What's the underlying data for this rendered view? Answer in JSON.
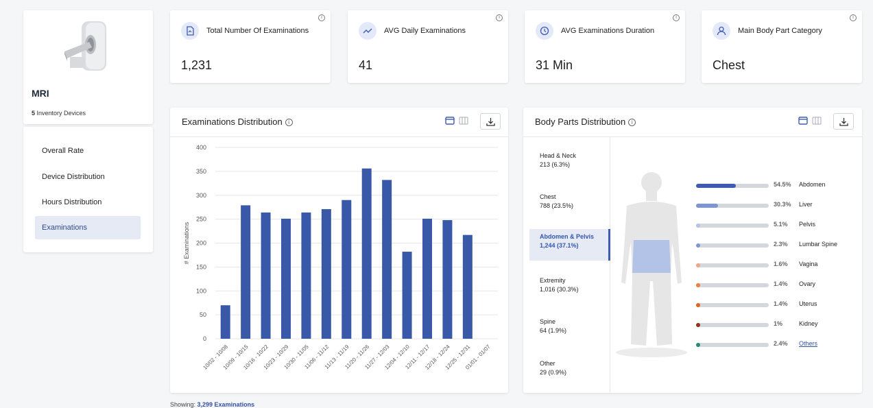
{
  "device": {
    "name": "MRI",
    "count": "5",
    "count_label": " Inventory Devices"
  },
  "nav": {
    "items": [
      {
        "label": "Overall Rate"
      },
      {
        "label": "Device Distribution"
      },
      {
        "label": "Hours Distribution"
      },
      {
        "label": "Examinations"
      }
    ],
    "active": "Examinations"
  },
  "kpis": [
    {
      "title": "Total Number Of Examinations",
      "value": "1,231",
      "icon": "file-document-icon"
    },
    {
      "title": "AVG Daily Examinations",
      "value": "41",
      "icon": "trend-line-icon"
    },
    {
      "title": "AVG Examinations Duration",
      "value": "31 Min",
      "icon": "clock-icon"
    },
    {
      "title": "Main Body Part Category",
      "value": "Chest",
      "icon": "person-icon"
    }
  ],
  "exam_panel": {
    "title": "Examinations Distribution"
  },
  "body_panel": {
    "title": "Body Parts Distribution"
  },
  "colors": {
    "accent": "#3d5bb0",
    "bar": "#3a58a8",
    "track": "#d4d7dc",
    "active_bg": "#e6eaf5",
    "link": "#3451a8"
  },
  "body_parts": [
    {
      "name": "Head & Neck",
      "value": "213 (6.3%)"
    },
    {
      "name": "Chest",
      "value": "788 (23.5%)"
    },
    {
      "name": "Abdomen & Pelvis",
      "value": "1,244 (37.1%)",
      "active": true
    },
    {
      "name": "Extremity",
      "value": "1,016 (30.3%)"
    },
    {
      "name": "Spine",
      "value": "64 (1.9%)"
    },
    {
      "name": "Other",
      "value": "29 (0.9%)"
    }
  ],
  "sub_parts": [
    {
      "pct_label": "54.5%",
      "label": "Abdomen",
      "fill": 0.545,
      "color": "#3d5bb0"
    },
    {
      "pct_label": "30.3%",
      "label": "Liver",
      "fill": 0.303,
      "color": "#7d95d6"
    },
    {
      "pct_label": "5.1%",
      "label": "Pelvis",
      "fill": 0.051,
      "color": "#b5c3ea"
    },
    {
      "pct_label": "2.3%",
      "label": "Lumbar Spine",
      "fill": 0.023,
      "color": "#7d95d6"
    },
    {
      "pct_label": "1.6%",
      "label": "Vagina",
      "fill": 0.016,
      "color": "#f0a58a"
    },
    {
      "pct_label": "1.4%",
      "label": "Ovary",
      "fill": 0.014,
      "color": "#ee7f3c"
    },
    {
      "pct_label": "1.4%",
      "label": "Uterus",
      "fill": 0.014,
      "color": "#e3641e"
    },
    {
      "pct_label": "1%",
      "label": "Kidney",
      "fill": 0.01,
      "color": "#8e3320"
    },
    {
      "pct_label": "2.4%",
      "label": "Others",
      "fill": 0.024,
      "color": "#2a8a7a",
      "link": true
    }
  ],
  "footer": {
    "prefix": "Showing: ",
    "value": "3,299 Examinations"
  },
  "chart_data": {
    "type": "bar",
    "categories": [
      "10/02 - 10/08",
      "10/09 - 10/15",
      "10/16 - 10/22",
      "10/23 - 10/29",
      "10/30 - 11/05",
      "11/06 - 11/12",
      "11/13 - 11/19",
      "11/20 - 11/26",
      "11/27 - 12/03",
      "12/04 - 12/10",
      "12/11 - 12/17",
      "12/18 - 12/24",
      "12/25 - 12/31",
      "01/01 - 01/07"
    ],
    "values": [
      70,
      279,
      264,
      251,
      264,
      271,
      290,
      356,
      332,
      182,
      251,
      248,
      217,
      0
    ],
    "ylabel": "# Examinations",
    "xlabel": "",
    "yticks": [
      0,
      50,
      100,
      150,
      200,
      250,
      300,
      350,
      400
    ],
    "ylim": [
      0,
      400
    ],
    "grid": true
  }
}
